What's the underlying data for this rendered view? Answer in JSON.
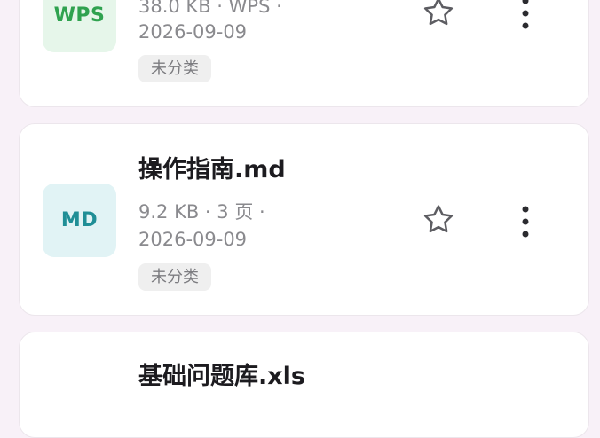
{
  "files": [
    {
      "badge": "WPS",
      "title": "",
      "size": "38.0 KB",
      "sep1": " · ",
      "kind": "WPS",
      "sep2": " ·",
      "date": "2026-09-09",
      "tag": "未分类"
    },
    {
      "badge": "MD",
      "title": "操作指南.md",
      "size": "9.2 KB",
      "sep1": " · ",
      "kind": "3 页",
      "sep2": " ·",
      "date": "2026-09-09",
      "tag": "未分类"
    },
    {
      "title": "基础问题库.xls"
    }
  ],
  "colors": {
    "wps_badge_bg": "#e6f6ea",
    "wps_badge_text": "#2fa24f",
    "md_badge_bg": "#e1f3f5",
    "md_badge_text": "#1f8e96",
    "icon_gray": "#5d5d62"
  }
}
